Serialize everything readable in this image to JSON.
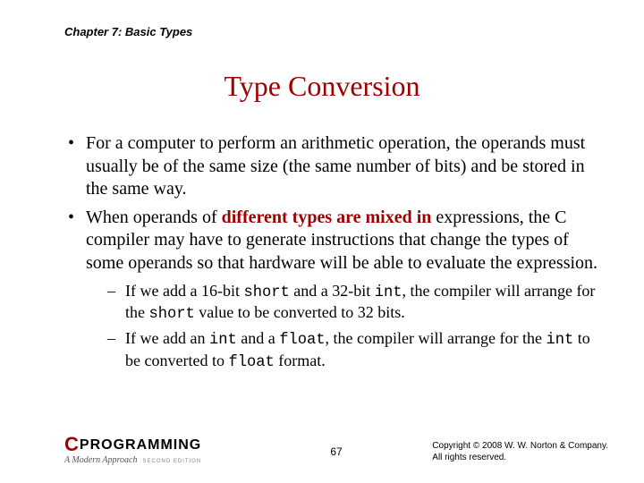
{
  "header": "Chapter 7: Basic Types",
  "title": "Type Conversion",
  "bullets": [
    {
      "text": "For a computer to perform an arithmetic operation, the operands must usually be of the same size (the same number of bits) and be stored in the same way."
    },
    {
      "pre": "When operands of ",
      "em": "different types are mixed in",
      "post": " expressions, the C compiler may have to generate instructions that change the types of some operands so that hardware will be able to evaluate the expression."
    }
  ],
  "subs": [
    {
      "p1": "If we add a 16-bit ",
      "c1": "short",
      "p2": " and a 32-bit ",
      "c2": "int",
      "p3": ", the compiler will arrange for the ",
      "c3": "short",
      "p4": " value to be converted to 32 bits."
    },
    {
      "p1": "If we add an ",
      "c1": "int",
      "p2": " and a ",
      "c2": "float",
      "p3": ", the compiler will arrange for the ",
      "c3": "int",
      "p4": " to be converted to ",
      "c4": "float",
      "p5": " format."
    }
  ],
  "logo": {
    "c": "C",
    "word": "PROGRAMMING",
    "sub": "A Modern Approach",
    "ed": "SECOND EDITION"
  },
  "page": "67",
  "copyright": {
    "l1": "Copyright © 2008 W. W. Norton & Company.",
    "l2": "All rights reserved."
  }
}
